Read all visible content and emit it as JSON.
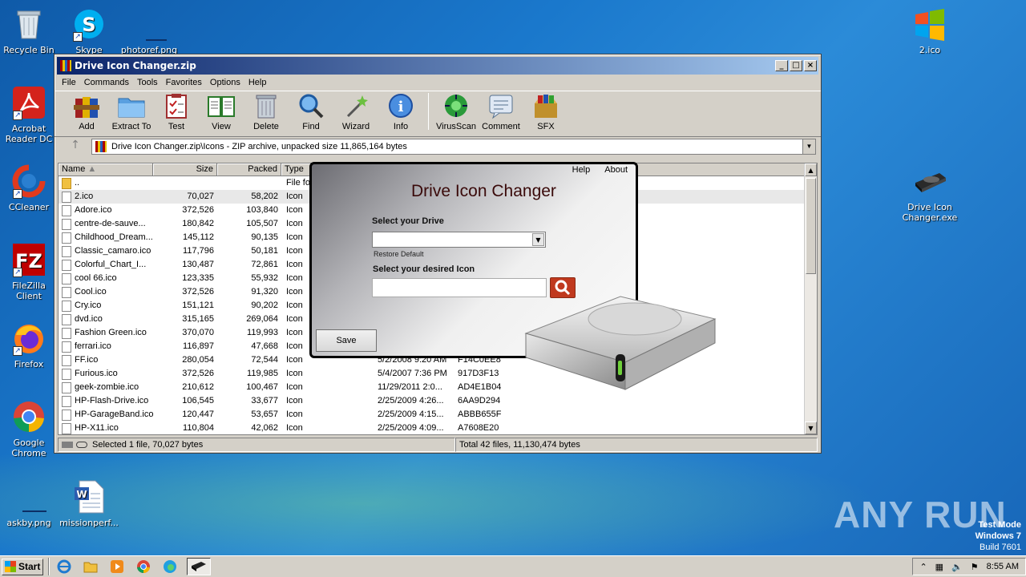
{
  "desktop": {
    "icons": [
      {
        "label": "Recycle Bin",
        "icon": "recycle-bin-icon"
      },
      {
        "label": "Skype",
        "icon": "skype-icon"
      },
      {
        "label": "photoref.png",
        "icon": "image-file-icon"
      },
      {
        "label": "Acrobat Reader DC",
        "icon": "acrobat-icon"
      },
      {
        "label": "CCleaner",
        "icon": "ccleaner-icon"
      },
      {
        "label": "FileZilla Client",
        "icon": "filezilla-icon"
      },
      {
        "label": "Firefox",
        "icon": "firefox-icon"
      },
      {
        "label": "Google Chrome",
        "icon": "chrome-icon"
      },
      {
        "label": "askby.png",
        "icon": "image-file-icon"
      },
      {
        "label": "missionperf...",
        "icon": "word-doc-icon"
      },
      {
        "label": "2.ico",
        "icon": "windows-logo-icon"
      },
      {
        "label": "Drive Icon Changer.exe",
        "icon": "drive-icon"
      }
    ]
  },
  "winrar": {
    "title": "Drive Icon Changer.zip",
    "menu": [
      "File",
      "Commands",
      "Tools",
      "Favorites",
      "Options",
      "Help"
    ],
    "toolbar": [
      {
        "label": "Add",
        "icon": "add-archive-icon"
      },
      {
        "label": "Extract To",
        "icon": "extract-folder-icon"
      },
      {
        "label": "Test",
        "icon": "test-clipboard-icon"
      },
      {
        "label": "View",
        "icon": "view-book-icon"
      },
      {
        "label": "Delete",
        "icon": "trash-icon"
      },
      {
        "label": "Find",
        "icon": "find-magnifier-icon"
      },
      {
        "label": "Wizard",
        "icon": "wizard-wand-icon"
      },
      {
        "label": "Info",
        "icon": "info-icon"
      },
      {
        "label": "VirusScan",
        "icon": "virus-scan-icon"
      },
      {
        "label": "Comment",
        "icon": "comment-icon"
      },
      {
        "label": "SFX",
        "icon": "sfx-box-icon"
      }
    ],
    "path": "Drive Icon Changer.zip\\Icons - ZIP archive, unpacked size 11,865,164 bytes",
    "columns": [
      "Name",
      "Size",
      "Packed",
      "Type"
    ],
    "rows": [
      {
        "name": "..",
        "size": "",
        "packed": "",
        "type": "File fo",
        "modified": "",
        "crc": "",
        "folder": true
      },
      {
        "name": "2.ico",
        "size": "70,027",
        "packed": "58,202",
        "type": "Icon",
        "modified": "",
        "crc": "",
        "selected": true
      },
      {
        "name": "Adore.ico",
        "size": "372,526",
        "packed": "103,840",
        "type": "Icon",
        "modified": "",
        "crc": ""
      },
      {
        "name": "centre-de-sauve...",
        "size": "180,842",
        "packed": "105,507",
        "type": "Icon",
        "modified": "",
        "crc": ""
      },
      {
        "name": "Childhood_Dream...",
        "size": "145,112",
        "packed": "90,135",
        "type": "Icon",
        "modified": "",
        "crc": ""
      },
      {
        "name": "Classic_camaro.ico",
        "size": "117,796",
        "packed": "50,181",
        "type": "Icon",
        "modified": "",
        "crc": ""
      },
      {
        "name": "Colorful_Chart_I...",
        "size": "130,487",
        "packed": "72,861",
        "type": "Icon",
        "modified": "",
        "crc": ""
      },
      {
        "name": "cool 66.ico",
        "size": "123,335",
        "packed": "55,932",
        "type": "Icon",
        "modified": "",
        "crc": ""
      },
      {
        "name": "Cool.ico",
        "size": "372,526",
        "packed": "91,320",
        "type": "Icon",
        "modified": "",
        "crc": ""
      },
      {
        "name": "Cry.ico",
        "size": "151,121",
        "packed": "90,202",
        "type": "Icon",
        "modified": "",
        "crc": ""
      },
      {
        "name": "dvd.ico",
        "size": "315,165",
        "packed": "269,064",
        "type": "Icon",
        "modified": "",
        "crc": ""
      },
      {
        "name": "Fashion Green.ico",
        "size": "370,070",
        "packed": "119,993",
        "type": "Icon",
        "modified": "",
        "crc": ""
      },
      {
        "name": "ferrari.ico",
        "size": "116,897",
        "packed": "47,668",
        "type": "Icon",
        "modified": "",
        "crc": ""
      },
      {
        "name": "FF.ico",
        "size": "280,054",
        "packed": "72,544",
        "type": "Icon",
        "modified": "5/2/2008 9:20 AM",
        "crc": "F14C0EE8"
      },
      {
        "name": "Furious.ico",
        "size": "372,526",
        "packed": "119,985",
        "type": "Icon",
        "modified": "5/4/2007 7:36 PM",
        "crc": "917D3F13"
      },
      {
        "name": "geek-zombie.ico",
        "size": "210,612",
        "packed": "100,467",
        "type": "Icon",
        "modified": "11/29/2011 2:0...",
        "crc": "AD4E1B04"
      },
      {
        "name": "HP-Flash-Drive.ico",
        "size": "106,545",
        "packed": "33,677",
        "type": "Icon",
        "modified": "2/25/2009 4:26...",
        "crc": "6AA9D294"
      },
      {
        "name": "HP-GarageBand.ico",
        "size": "120,447",
        "packed": "53,657",
        "type": "Icon",
        "modified": "2/25/2009 4:15...",
        "crc": "ABBB655F"
      },
      {
        "name": "HP-X11.ico",
        "size": "110,804",
        "packed": "42,062",
        "type": "Icon",
        "modified": "2/25/2009 4:09...",
        "crc": "A7608E20"
      }
    ],
    "status_left": "Selected 1 file, 70,027 bytes",
    "status_right": "Total 42 files, 11,130,474 bytes"
  },
  "dialog": {
    "title": "Drive Icon Changer",
    "menu_help": "Help",
    "menu_about": "About",
    "select_drive_label": "Select your Drive",
    "restore_default": "Restore Default",
    "select_icon_label": "Select your desired Icon",
    "save_label": "Save"
  },
  "taskbar": {
    "start": "Start",
    "clock": "8:55 AM"
  },
  "watermark": "ANY RUN",
  "test_mode": {
    "line1": "Test Mode",
    "line2": "Windows 7",
    "line3": "Build 7601"
  },
  "colors": {
    "accent": "#0a246a",
    "selection": "#e8e8e8",
    "search_button": "#c0391e"
  }
}
